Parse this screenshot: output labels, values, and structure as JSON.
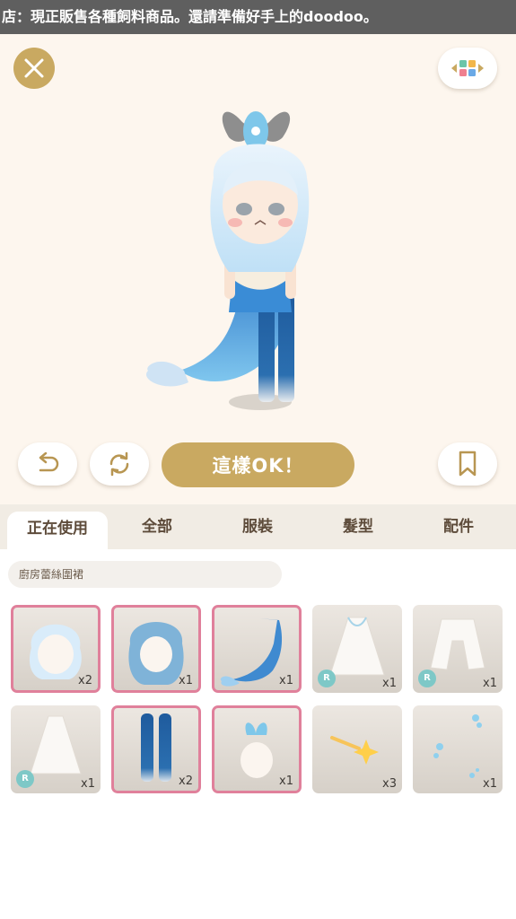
{
  "ticker": {
    "text": "店：現正販售各種飼料商品。還請準備好手上的doodoo。"
  },
  "toolbar": {
    "ok_label": "這樣OK！"
  },
  "tabs": [
    {
      "label": "正在使用",
      "active": true
    },
    {
      "label": "全部",
      "active": false
    },
    {
      "label": "服裝",
      "active": false
    },
    {
      "label": "髮型",
      "active": false
    },
    {
      "label": "配件",
      "active": false
    }
  ],
  "search": {
    "value": "廚房蕾絲圍裙"
  },
  "items": [
    {
      "icon": "short-blue-hair-icon",
      "qty": "x2",
      "selected": true,
      "rare": ""
    },
    {
      "icon": "long-blue-hair-icon",
      "qty": "x1",
      "selected": true,
      "rare": ""
    },
    {
      "icon": "mermaid-tail-outfit-icon",
      "qty": "x1",
      "selected": true,
      "rare": ""
    },
    {
      "icon": "lace-cape-dress-icon",
      "qty": "x1",
      "selected": false,
      "rare": "R"
    },
    {
      "icon": "lace-jacket-icon",
      "qty": "x1",
      "selected": false,
      "rare": "R"
    },
    {
      "icon": "lace-dress-icon",
      "qty": "x1",
      "selected": false,
      "rare": "R"
    },
    {
      "icon": "blue-leggings-icon",
      "qty": "x2",
      "selected": true,
      "rare": ""
    },
    {
      "icon": "shell-hair-ornament-icon",
      "qty": "x1",
      "selected": true,
      "rare": ""
    },
    {
      "icon": "sparkle-star-effect-icon",
      "qty": "x3",
      "selected": false,
      "rare": ""
    },
    {
      "icon": "bubbles-effect-icon",
      "qty": "x1",
      "selected": false,
      "rare": ""
    }
  ],
  "colors": {
    "accent": "#c9a961",
    "selected_border": "#e0809b",
    "rare_badge": "#7ec8c7"
  }
}
